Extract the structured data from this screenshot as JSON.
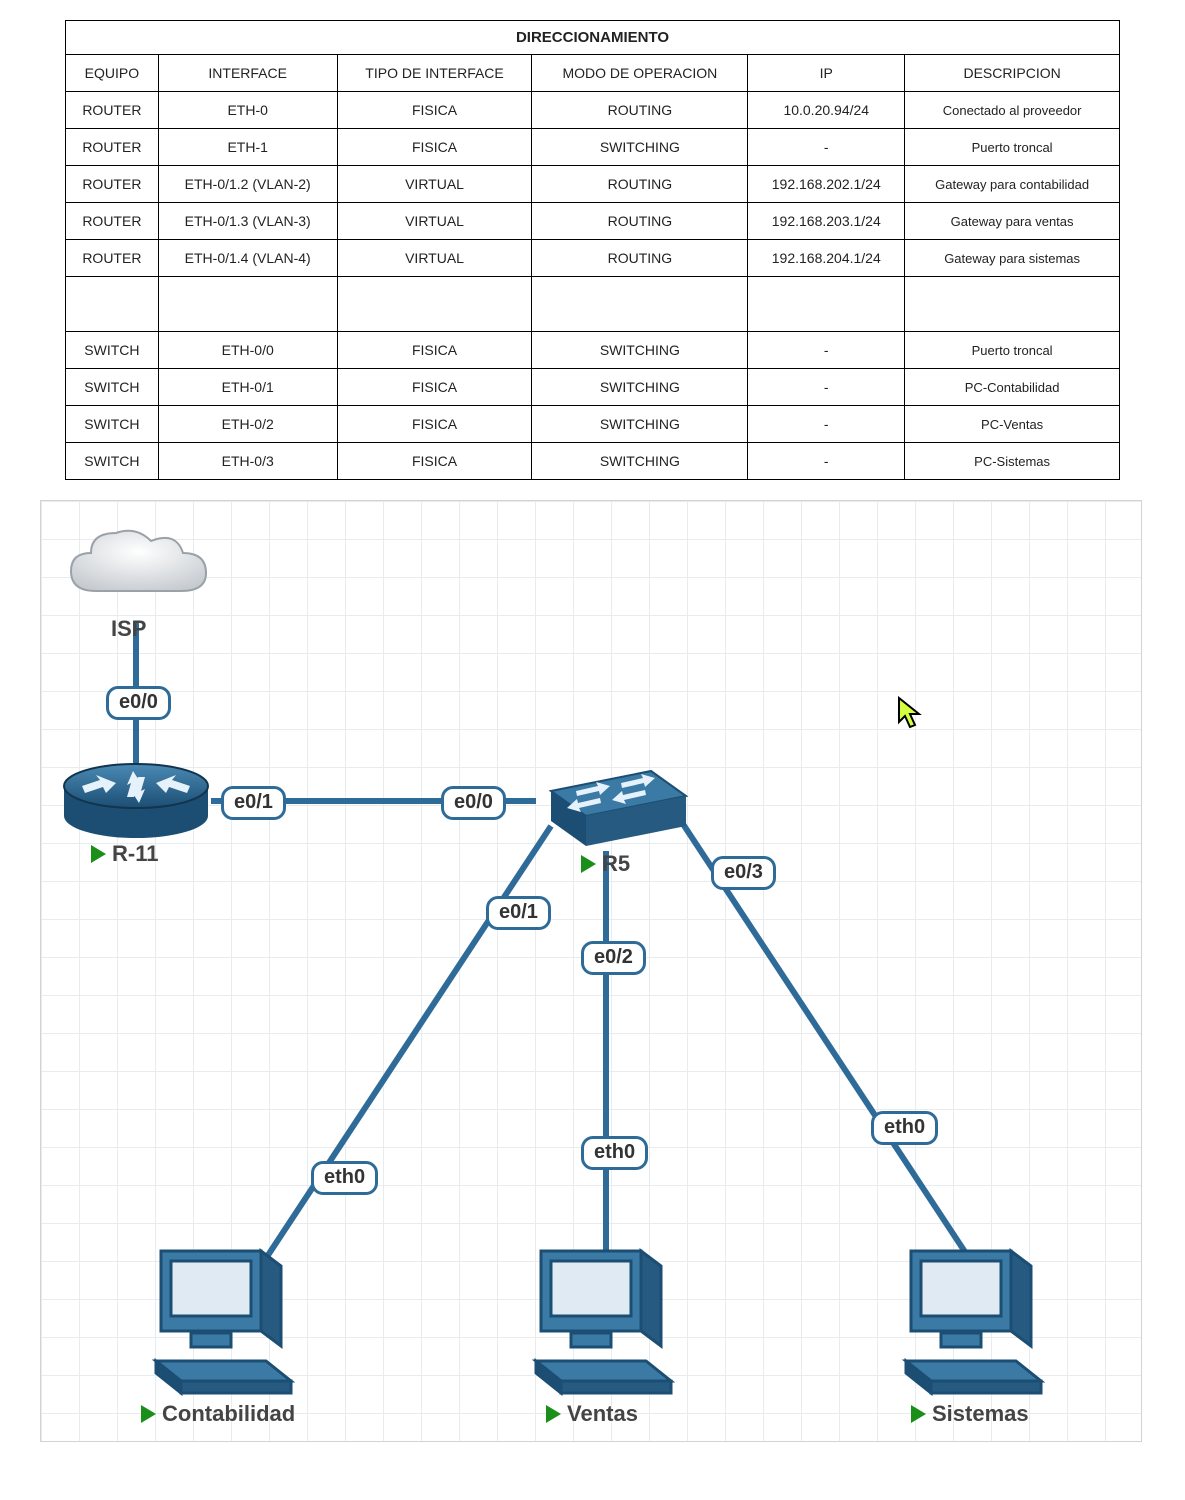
{
  "table": {
    "title": "DIRECCIONAMIENTO",
    "headers": [
      "EQUIPO",
      "INTERFACE",
      "TIPO DE INTERFACE",
      "MODO DE OPERACION",
      "IP",
      "DESCRIPCION"
    ],
    "rows": [
      {
        "equipo": "ROUTER",
        "interface": "ETH-0",
        "tipo": "FISICA",
        "modo": "ROUTING",
        "ip": "10.0.20.94/24",
        "desc": "Conectado al proveedor"
      },
      {
        "equipo": "ROUTER",
        "interface": "ETH-1",
        "tipo": "FISICA",
        "modo": "SWITCHING",
        "ip": "-",
        "desc": "Puerto troncal"
      },
      {
        "equipo": "ROUTER",
        "interface": "ETH-0/1.2 (VLAN-2)",
        "tipo": "VIRTUAL",
        "modo": "ROUTING",
        "ip": "192.168.202.1/24",
        "desc": "Gateway para contabilidad"
      },
      {
        "equipo": "ROUTER",
        "interface": "ETH-0/1.3 (VLAN-3)",
        "tipo": "VIRTUAL",
        "modo": "ROUTING",
        "ip": "192.168.203.1/24",
        "desc": "Gateway para ventas"
      },
      {
        "equipo": "ROUTER",
        "interface": "ETH-0/1.4 (VLAN-4)",
        "tipo": "VIRTUAL",
        "modo": "ROUTING",
        "ip": "192.168.204.1/24",
        "desc": "Gateway para sistemas"
      },
      {
        "empty": true
      },
      {
        "equipo": "SWITCH",
        "interface": "ETH-0/0",
        "tipo": "FISICA",
        "modo": "SWITCHING",
        "ip": "-",
        "desc": "Puerto troncal"
      },
      {
        "equipo": "SWITCH",
        "interface": "ETH-0/1",
        "tipo": "FISICA",
        "modo": "SWITCHING",
        "ip": "-",
        "desc": "PC-Contabilidad"
      },
      {
        "equipo": "SWITCH",
        "interface": "ETH-0/2",
        "tipo": "FISICA",
        "modo": "SWITCHING",
        "ip": "-",
        "desc": "PC-Ventas"
      },
      {
        "equipo": "SWITCH",
        "interface": "ETH-0/3",
        "tipo": "FISICA",
        "modo": "SWITCHING",
        "ip": "-",
        "desc": "PC-Sistemas"
      }
    ]
  },
  "diagram": {
    "nodes": {
      "isp": "ISP",
      "r11": "R-11",
      "r5": "R5",
      "contabilidad": "Contabilidad",
      "ventas": "Ventas",
      "sistemas": "Sistemas"
    },
    "ifaces": {
      "r11_e00": "e0/0",
      "r11_e01": "e0/1",
      "sw_e00": "e0/0",
      "sw_e01": "e0/1",
      "sw_e02": "e0/2",
      "sw_e03": "e0/3",
      "pc1_eth0": "eth0",
      "pc2_eth0": "eth0",
      "pc3_eth0": "eth0"
    }
  }
}
